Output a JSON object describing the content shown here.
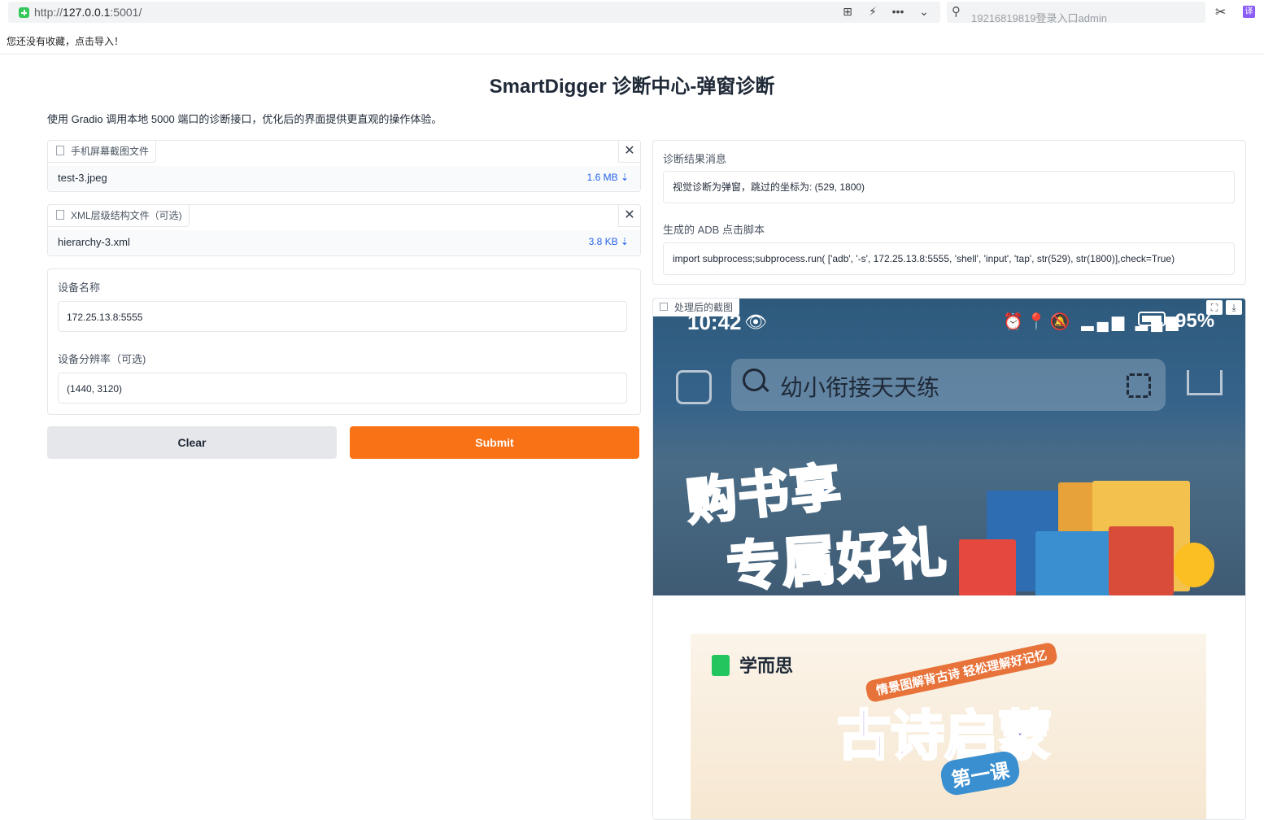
{
  "browser": {
    "url_prefix": "http://",
    "url_host": "127.0.0.1",
    "url_rest": ":5001/",
    "search_text": "19216819819登录入口admin",
    "bookmark_hint": "您还没有收藏，点击导入！",
    "tool_icons": [
      "translate-icon",
      "lightning-icon",
      "more-icon",
      "chevron-down-icon"
    ]
  },
  "page": {
    "title": "SmartDigger 诊断中心-弹窗诊断",
    "description": "使用 Gradio 调用本地 5000 端口的诊断接口，优化后的界面提供更直观的操作体验。"
  },
  "screenshot_file": {
    "label": "手机屏幕截图文件",
    "file_name": "test-3.jpeg",
    "file_size": "1.6 MB ⇣"
  },
  "xml_file": {
    "label": "XML层级结构文件（可选)",
    "file_name": "hierarchy-3.xml",
    "file_size": "3.8 KB ⇣"
  },
  "device": {
    "name_label": "设备名称",
    "name_value": "172.25.13.8:5555",
    "resolution_label": "设备分辨率（可选)",
    "resolution_value": "(1440, 3120)"
  },
  "buttons": {
    "clear": "Clear",
    "submit": "Submit"
  },
  "result": {
    "message_label": "诊断结果消息",
    "message_value": "视觉诊断为弹窗，跳过的坐标为: (529, 1800)",
    "script_label": "生成的 ADB 点击脚本",
    "script_value": "import subprocess;subprocess.run( ['adb', '-s', 172.25.13.8:5555, 'shell', 'input', 'tap', str(529), str(1800)],check=True)"
  },
  "processed_image": {
    "label": "处理后的截图",
    "phone": {
      "time": "10:42",
      "battery": "95%",
      "search_text": "幼小衔接天天练",
      "promo_line1": "购书享",
      "promo_line2": "专属好礼",
      "poster_brand": "学而思",
      "poster_ribbon": "情景图解背古诗 轻松理解好记忆",
      "poster_title": "古诗启蒙",
      "poster_tag": "第一课"
    }
  },
  "colors": {
    "submit": "#f97316",
    "clear": "#e5e7eb",
    "accent_link": "#2563eb"
  }
}
